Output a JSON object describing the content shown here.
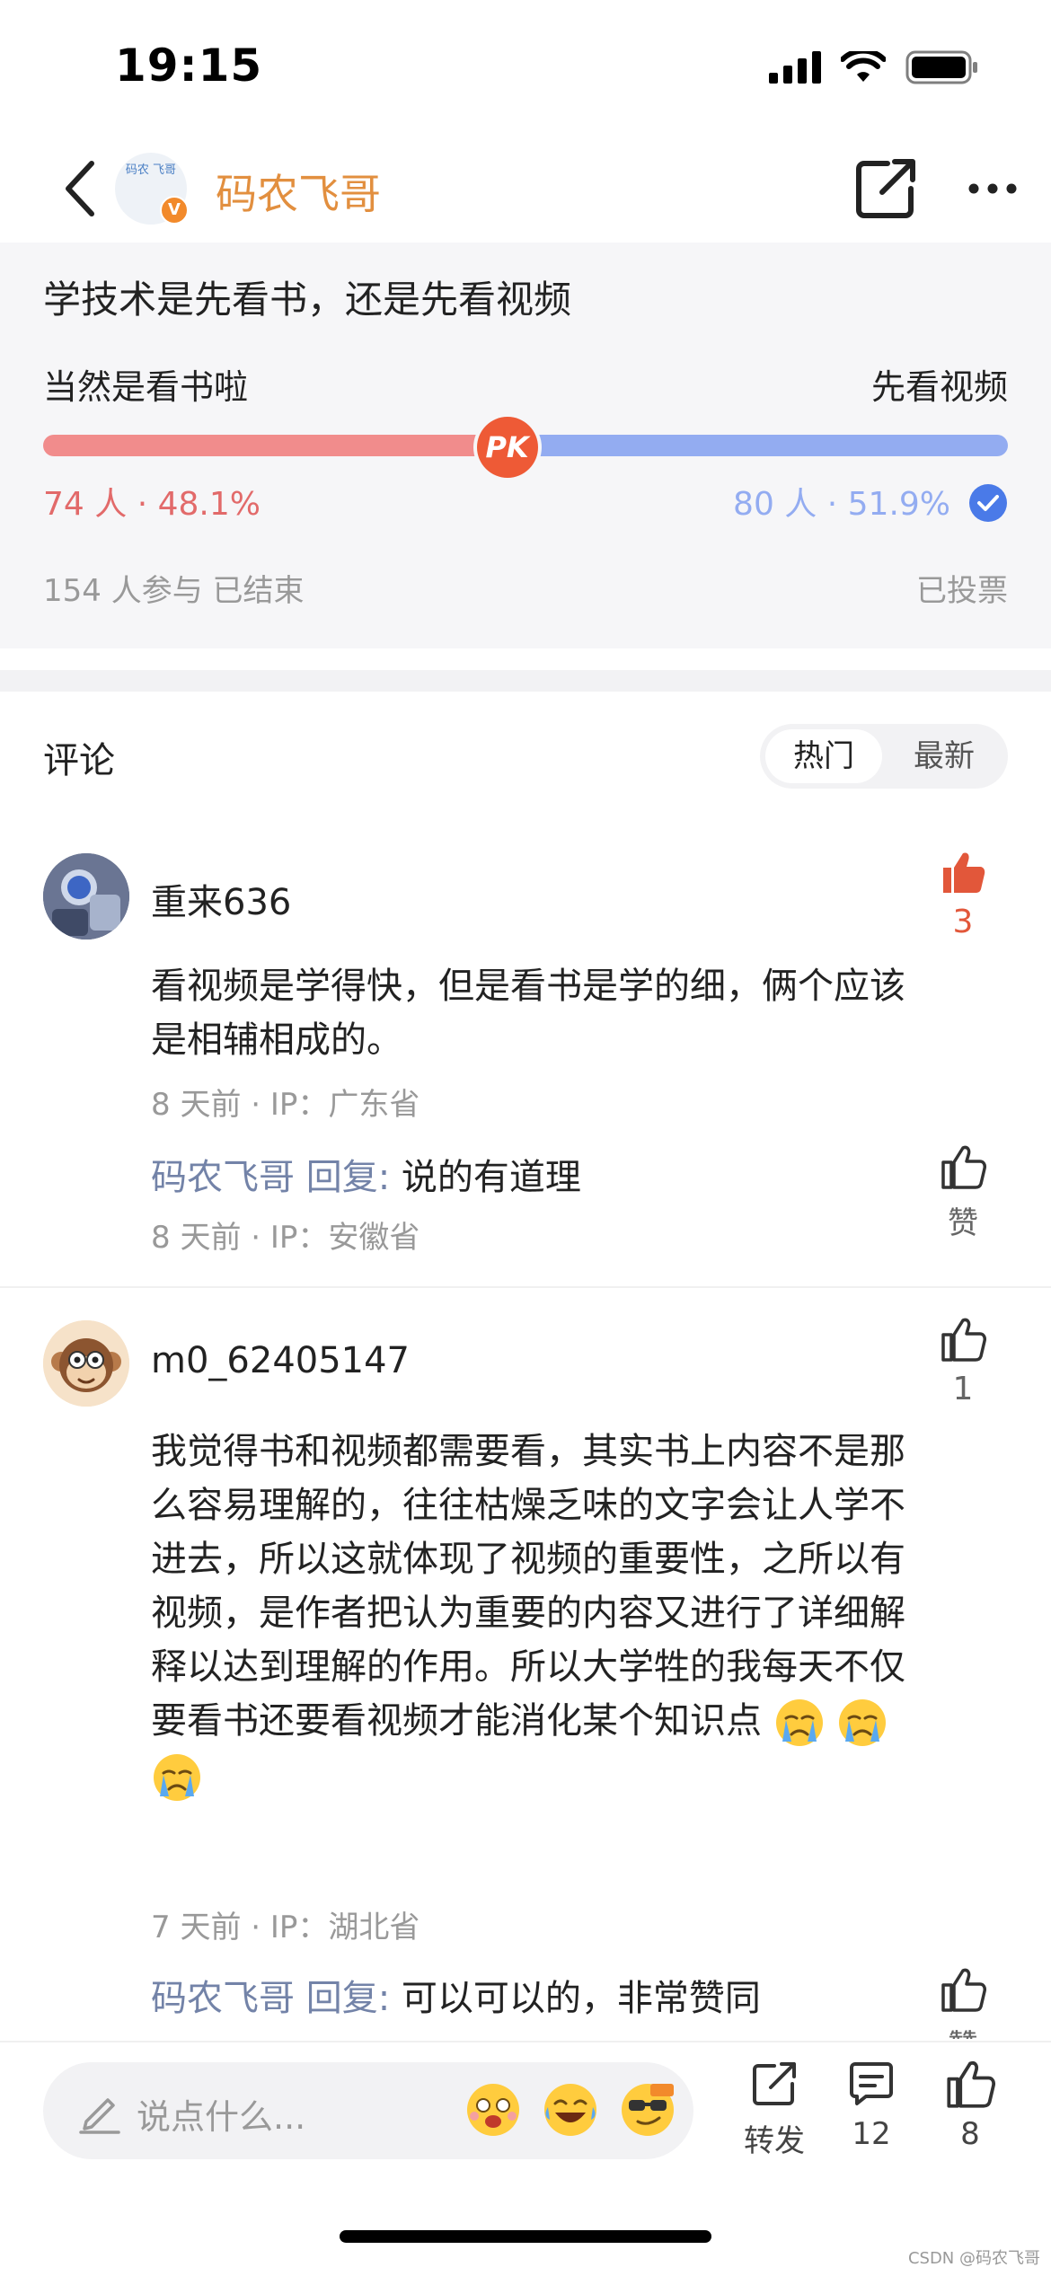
{
  "status_bar": {
    "time": "19:15"
  },
  "nav": {
    "title": "码农飞哥",
    "avatar_text": "码农 飞哥",
    "badge": "V"
  },
  "poll": {
    "question": "学技术是先看书，还是先看视频",
    "left_option": "当然是看书啦",
    "right_option": "先看视频",
    "pk_label": "PK",
    "left_share": 0.481,
    "left_count": "74 人 · 48.1%",
    "right_count": "80 人 · 51.9%",
    "participants": "154 人参与  已结束",
    "status": "已投票",
    "colors": {
      "left": "#f18c8c",
      "right": "#93acf1",
      "badge": "#ee5a36"
    }
  },
  "comments_header": {
    "title": "评论",
    "tabs": [
      "热门",
      "最新"
    ],
    "active_tab": "热门"
  },
  "comments": [
    {
      "user": "重来636",
      "text": "看视频是学得快，但是看书是学的细，俩个应该是相辅相成的。",
      "meta": "8 天前 · IP：广东省",
      "likes": "3",
      "reply": {
        "author": "码农飞哥",
        "label": " 回复:",
        "text": " 说的有道理",
        "meta": "8 天前 · IP：安徽省",
        "like_label": "赞"
      }
    },
    {
      "user": "m0_62405147",
      "text": "我觉得书和视频都需要看，其实书上内容不是那么容易理解的，往往枯燥乏味的文字会让人学不进去，所以这就体现了视频的重要性，之所以有视频，是作者把认为重要的内容又进行了详细解释以达到理解的作用。所以大学牲的我每天不仅要看书还要看视频才能消化某个知识点",
      "emojis": [
        "crying-face-icon",
        "crying-face-icon",
        "crying-face-icon"
      ],
      "meta": "7 天前 · IP：湖北省",
      "likes": "1",
      "reply": {
        "author": "码农飞哥",
        "label": " 回复:",
        "text": " 可以可以的，非常赞同",
        "like_label": "赞"
      }
    }
  ],
  "bottom_bar": {
    "placeholder": "说点什么...",
    "emojis": [
      "dizzy-face-icon",
      "laughing-tears-icon",
      "cool-glasses-icon"
    ],
    "share_label": "转发",
    "comment_count": "12",
    "like_count": "8"
  },
  "watermark": "CSDN @码农飞哥"
}
